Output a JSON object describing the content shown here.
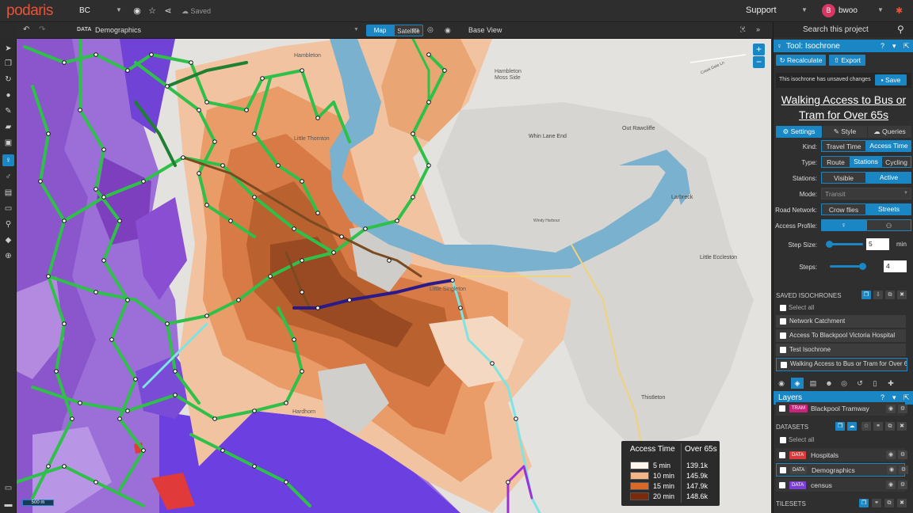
{
  "topbar": {
    "logo": "podaris",
    "project": "BC",
    "saved": "Saved",
    "support": "Support",
    "user_initial": "B",
    "user_name": "bwoo"
  },
  "mapbar": {
    "data_tag": "DATA",
    "dataset": "Demographics",
    "map_btn": "Map",
    "satellite_btn": "Satellite",
    "base_view": "Base View"
  },
  "map": {
    "labels": {
      "hambleton": "Hambleton",
      "moss_side": "Moss Side",
      "whin_lane_end": "Whin Lane End",
      "out_rawcliffe": "Out Rawcliffe",
      "little_thornton": "Little Thornton",
      "larbreck": "Larbreck",
      "little_eccleston": "Little Eccleston",
      "little_singleton": "Little Singleton",
      "thistleton": "Thistleton",
      "hardhorn": "Hardhorn",
      "creek_date": "Creek Date Ln",
      "singleton": "Singleton",
      "windy_harbour": "Windy Harbour",
      "river_wyre": "River Wyre"
    },
    "scale": "500 m",
    "zoom_in": "+",
    "zoom_out": "−"
  },
  "legend": {
    "col1": "Access Time",
    "col2": "Over 65s",
    "rows": [
      {
        "label": "5 min",
        "value": "139.1k",
        "color": "#fff7ee"
      },
      {
        "label": "10 min",
        "value": "145.9k",
        "color": "#f2b588"
      },
      {
        "label": "15 min",
        "value": "147.9k",
        "color": "#d9692a"
      },
      {
        "label": "20 min",
        "value": "148.6k",
        "color": "#7b2a0d"
      }
    ]
  },
  "panel": {
    "search": "Search this project",
    "tool_title": "Tool: Isochrone",
    "recalculate": "Recalculate",
    "export": "Export",
    "unsaved": "This isochrone has unsaved changes",
    "save": "Save",
    "title_line1": "Walking Access to Bus or",
    "title_line2": "Tram for Over 65s",
    "tabs": [
      "Settings",
      "Style",
      "Queries"
    ],
    "kind_label": "Kind:",
    "kind_opts": [
      "Travel Time",
      "Access Time"
    ],
    "type_label": "Type:",
    "type_opts": [
      "Route",
      "Stations",
      "Cycling"
    ],
    "stations_label": "Stations:",
    "stations_opts": [
      "Visible",
      "Active"
    ],
    "mode_label": "Mode:",
    "mode_value": "Transit",
    "road_label": "Road Network:",
    "road_opts": [
      "Crow flies",
      "Streets"
    ],
    "access_label": "Access Profile:",
    "step_size_label": "Step Size:",
    "step_size_value": "5",
    "step_size_unit": "min",
    "steps_label": "Steps:",
    "steps_value": "4",
    "saved_iso_header": "SAVED ISOCHRONES",
    "select_all": "Select all",
    "saved_isochrones": [
      "Network Catchment",
      "Access To Blackpool Victoria Hospital",
      "Test Isochrone",
      "Walking Access to Bus or Tram for Over 65s"
    ],
    "layers_title": "Layers",
    "tram_tag": "TRAM",
    "tram_name": "Blackpool Tramway",
    "datasets_header": "DATASETS",
    "datasets_select_all": "Select all",
    "datasets": [
      {
        "tag": "DATA",
        "name": "Hospitals",
        "color": "#d93a3a"
      },
      {
        "tag": "DATA",
        "name": "Demographics",
        "color": "#444444"
      },
      {
        "tag": "DATA",
        "name": "census",
        "color": "#7b3fd6"
      }
    ],
    "tilesets_header": "TILESETS"
  }
}
